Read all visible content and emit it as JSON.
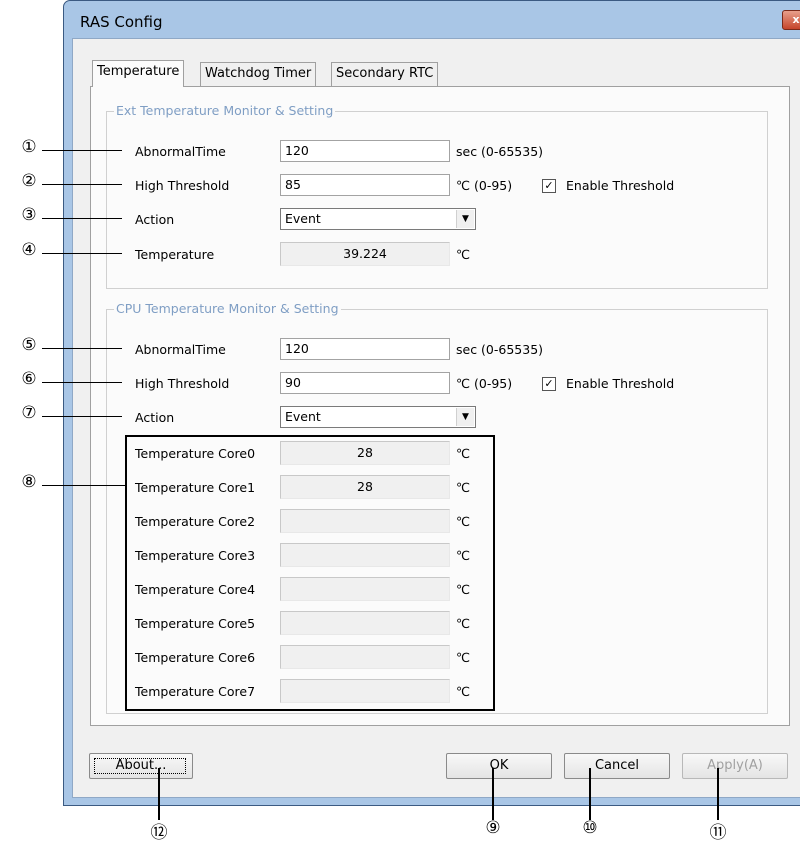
{
  "window": {
    "title": "RAS Config",
    "close_label": "x"
  },
  "tabs": [
    {
      "label": "Temperature",
      "active": true
    },
    {
      "label": "Watchdog Timer",
      "active": false
    },
    {
      "label": "Secondary RTC",
      "active": false
    }
  ],
  "ext_group": {
    "title": "Ext Temperature Monitor & Setting",
    "abnormal_label": "AbnormalTime",
    "abnormal_value": "120",
    "abnormal_unit": "sec (0-65535)",
    "threshold_label": "High Threshold",
    "threshold_value": "85",
    "threshold_unit": "℃ (0-95)",
    "enable_label": "Enable Threshold",
    "enable_checked": "✓",
    "action_label": "Action",
    "action_value": "Event",
    "temp_label": "Temperature",
    "temp_value": "39.224",
    "temp_unit": "℃"
  },
  "cpu_group": {
    "title": "CPU Temperature Monitor & Setting",
    "abnormal_label": "AbnormalTime",
    "abnormal_value": "120",
    "abnormal_unit": "sec (0-65535)",
    "threshold_label": "High Threshold",
    "threshold_value": "90",
    "threshold_unit": "℃ (0-95)",
    "enable_label": "Enable Threshold",
    "enable_checked": "✓",
    "action_label": "Action",
    "action_value": "Event",
    "cores": [
      {
        "label": "Temperature Core0",
        "value": "28",
        "unit": "℃"
      },
      {
        "label": "Temperature Core1",
        "value": "28",
        "unit": "℃"
      },
      {
        "label": "Temperature Core2",
        "value": "",
        "unit": "℃"
      },
      {
        "label": "Temperature Core3",
        "value": "",
        "unit": "℃"
      },
      {
        "label": "Temperature Core4",
        "value": "",
        "unit": "℃"
      },
      {
        "label": "Temperature Core5",
        "value": "",
        "unit": "℃"
      },
      {
        "label": "Temperature Core6",
        "value": "",
        "unit": "℃"
      },
      {
        "label": "Temperature Core7",
        "value": "",
        "unit": "℃"
      }
    ]
  },
  "buttons": {
    "about": "About...",
    "ok": "OK",
    "cancel": "Cancel",
    "apply": "Apply(A)"
  },
  "callouts": [
    "①",
    "②",
    "③",
    "④",
    "⑤",
    "⑥",
    "⑦",
    "⑧",
    "⑨",
    "⑩",
    "⑪",
    "⑫"
  ],
  "dropdown_arrow": "▼"
}
